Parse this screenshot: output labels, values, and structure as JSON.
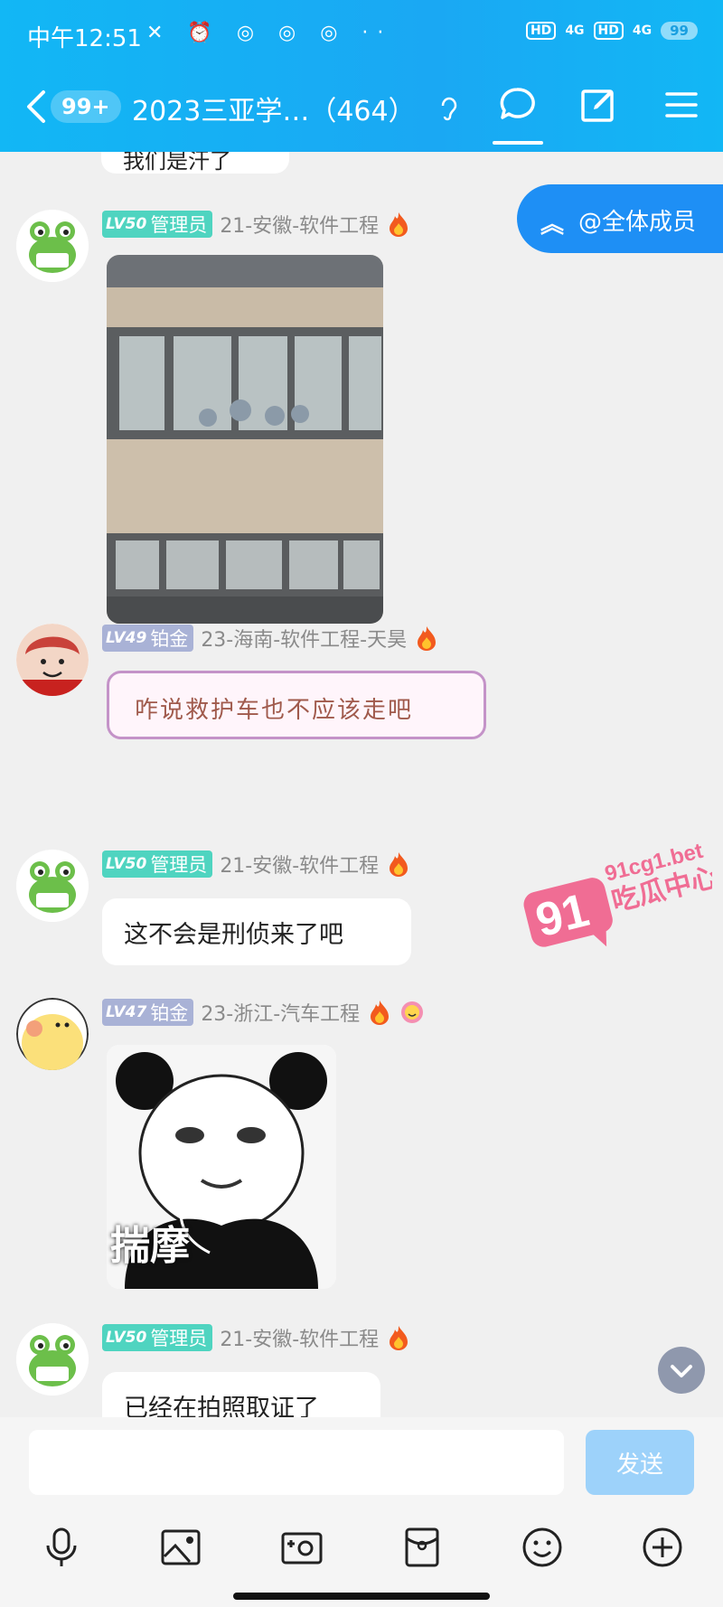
{
  "status_bar": {
    "time": "中午12:51",
    "icons_left": "✕ ⏰ ◎ ◎ ◎ ··",
    "hd1": "HD",
    "sig1": "4G",
    "hd2": "HD",
    "sig2": "4G",
    "battery": "99"
  },
  "nav": {
    "unread_count": "99+",
    "title": "2023三亚学…（464）",
    "icons": [
      "back-icon",
      "ear-icon",
      "chat-icon",
      "edit-icon",
      "menu-icon"
    ]
  },
  "previous_message_text": "我们是汗了",
  "at_all": {
    "label": "@全体成员",
    "icon": "double-chevron-up-icon"
  },
  "messages": [
    {
      "level": "LV50",
      "role": "管理员",
      "nickname": "21-安徽-软件工程",
      "type": "image",
      "image_desc": "building-photo"
    },
    {
      "level": "LV49",
      "role": "铂金",
      "nickname": "23-海南-软件工程-天昊",
      "type": "text",
      "text": "咋说救护车也不应该走吧"
    },
    {
      "level": "LV50",
      "role": "管理员",
      "nickname": "21-安徽-软件工程",
      "type": "text",
      "text": "这不会是刑侦来了吧"
    },
    {
      "level": "LV47",
      "role": "铂金",
      "nickname": "23-浙江-汽车工程",
      "type": "sticker",
      "sticker_text": "揣摩"
    },
    {
      "level": "LV50",
      "role": "管理员",
      "nickname": "21-安徽-软件工程",
      "type": "text",
      "text": "已经在拍照取证了"
    }
  ],
  "watermark": {
    "number": "91",
    "site": "91cg1.bet",
    "label": "吃瓜中心"
  },
  "input": {
    "placeholder": "",
    "send_label": "发送"
  },
  "toolbar_icons": [
    "microphone-icon",
    "image-icon",
    "camera-icon",
    "red-packet-icon",
    "emoji-icon",
    "plus-icon"
  ],
  "colors": {
    "header": "#12b7f5",
    "admin_badge": "#4fd4c0",
    "platinum_badge": "#a9b2d6",
    "send_button": "#9dd2fa",
    "at_all_button": "#1e8ff5"
  }
}
